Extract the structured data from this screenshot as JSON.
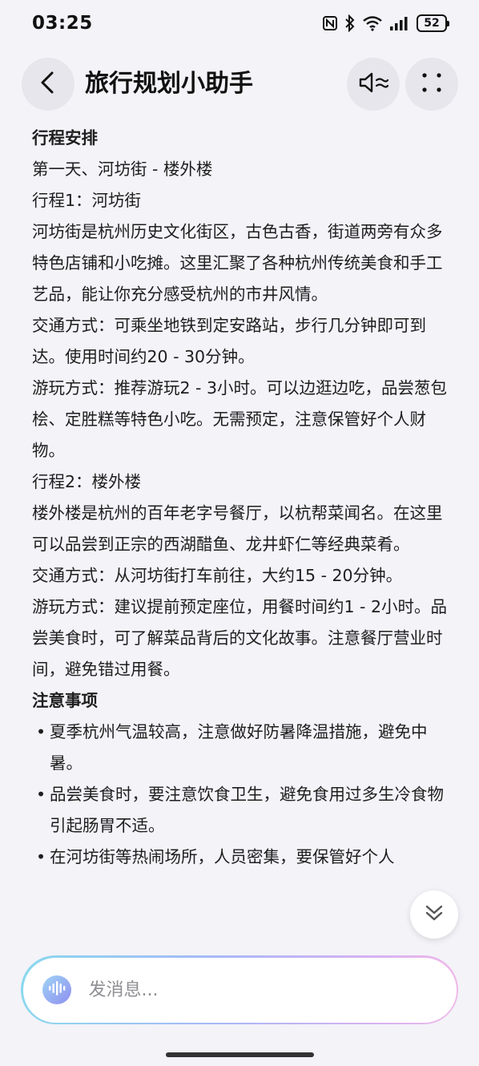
{
  "status_bar": {
    "time": "03:25",
    "battery": "52",
    "icons": [
      "nfc-icon",
      "bluetooth-icon",
      "wifi-icon",
      "signal-icon",
      "battery-icon"
    ]
  },
  "header": {
    "title": "旅行规划小助手",
    "back_icon": "back-arrow-icon",
    "sound_icon": "speaker-icon",
    "more_icon": "more-dots-icon"
  },
  "content": {
    "section1_title": "行程安排",
    "day1": "第一天、河坊街 - 楼外楼",
    "item1_title": "行程1：河坊街",
    "item1_desc": "河坊街是杭州历史文化街区，古色古香，街道两旁有众多特色店铺和小吃摊。这里汇聚了各种杭州传统美食和手工艺品，能让你充分感受杭州的市井风情。",
    "item1_transport": "交通方式：可乘坐地铁到定安路站，步行几分钟即可到达。使用时间约20 - 30分钟。",
    "item1_play": "游玩方式：推荐游玩2 - 3小时。可以边逛边吃，品尝葱包桧、定胜糕等特色小吃。无需预定，注意保管好个人财物。",
    "item2_title": "行程2：楼外楼",
    "item2_desc": "楼外楼是杭州的百年老字号餐厅，以杭帮菜闻名。在这里可以品尝到正宗的西湖醋鱼、龙井虾仁等经典菜肴。",
    "item2_transport": "交通方式：从河坊街打车前往，大约15 - 20分钟。",
    "item2_play": "游玩方式：建议提前预定座位，用餐时间约1 - 2小时。品尝美食时，可了解菜品背后的文化故事。注意餐厅营业时间，避免错过用餐。",
    "section2_title": "注意事项",
    "bullet_symbol": "•",
    "notes": [
      "夏季杭州气温较高，注意做好防暑降温措施，避免中暑。",
      "品尝美食时，要注意饮食卫生，避免食用过多生冷食物引起肠胃不适。",
      "在河坊街等热闹场所，人员密集，要保管好个人"
    ]
  },
  "input": {
    "placeholder": "发消息..."
  },
  "colors": {
    "background": "#f3f3f8",
    "input_gradient_start": "#8ad8ef",
    "input_gradient_end": "#f0b9e8"
  }
}
